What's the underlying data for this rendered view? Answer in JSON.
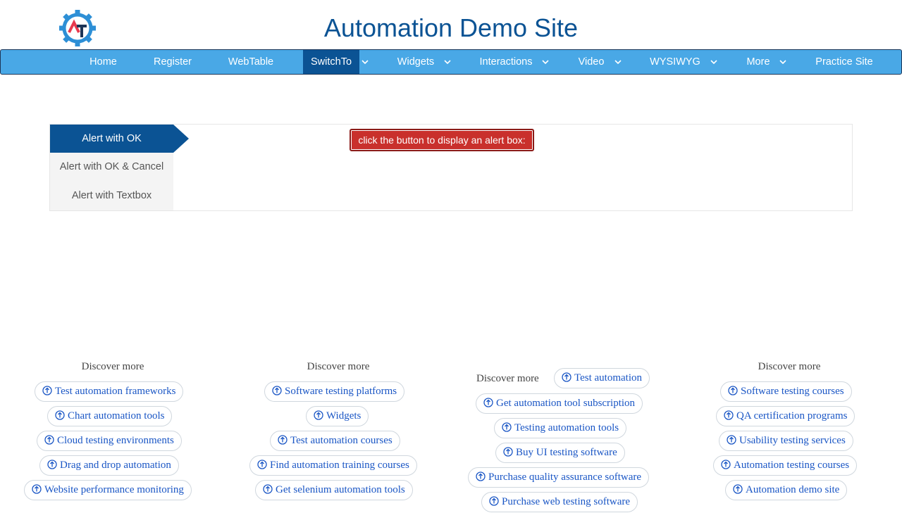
{
  "header": {
    "title": "Automation Demo Site",
    "logo_icon": "gear-logo-icon",
    "logo_colors": {
      "gear": "#2d8fd6",
      "a": "#e8394e",
      "t": "#1d3557"
    }
  },
  "nav": {
    "items": [
      {
        "label": "Home"
      },
      {
        "label": "Register"
      },
      {
        "label": "WebTable"
      },
      {
        "label": "SwitchTo",
        "active": true
      },
      {
        "label": "Widgets"
      },
      {
        "label": "Interactions"
      },
      {
        "label": "Video"
      },
      {
        "label": "WYSIWYG"
      },
      {
        "label": "More"
      },
      {
        "label": "Practice Site"
      }
    ]
  },
  "tabs": {
    "items": [
      {
        "label": "Alert with OK",
        "active": true
      },
      {
        "label": "Alert with OK & Cancel"
      },
      {
        "label": "Alert with Textbox"
      }
    ]
  },
  "alert_button": {
    "label": "click the button to display an alert box:"
  },
  "discover": {
    "columns": [
      {
        "label": "Discover more",
        "links": [
          "Test automation frameworks",
          "Chart automation tools",
          "Cloud testing environments",
          "Drag and drop automation",
          "Website performance monitoring"
        ]
      },
      {
        "label": "Discover more",
        "links": [
          "Software testing platforms",
          "Widgets",
          "Test automation courses",
          "Find automation training courses",
          "Get selenium automation tools"
        ]
      },
      {
        "label": "Discover more",
        "links": [
          "Test automation",
          "Get automation tool subscription",
          "Testing automation tools",
          "Buy UI testing software",
          "Purchase quality assurance software",
          "Purchase web testing software"
        ]
      },
      {
        "label": "Discover more",
        "links": [
          "Software testing courses",
          "QA certification programs",
          "Usability testing services",
          "Automation testing courses",
          "Automation demo site"
        ]
      }
    ]
  },
  "colors": {
    "brand": "#0b5394",
    "nav": "#49a8e6",
    "alert": "#c9302c",
    "link": "#1a56c5"
  }
}
